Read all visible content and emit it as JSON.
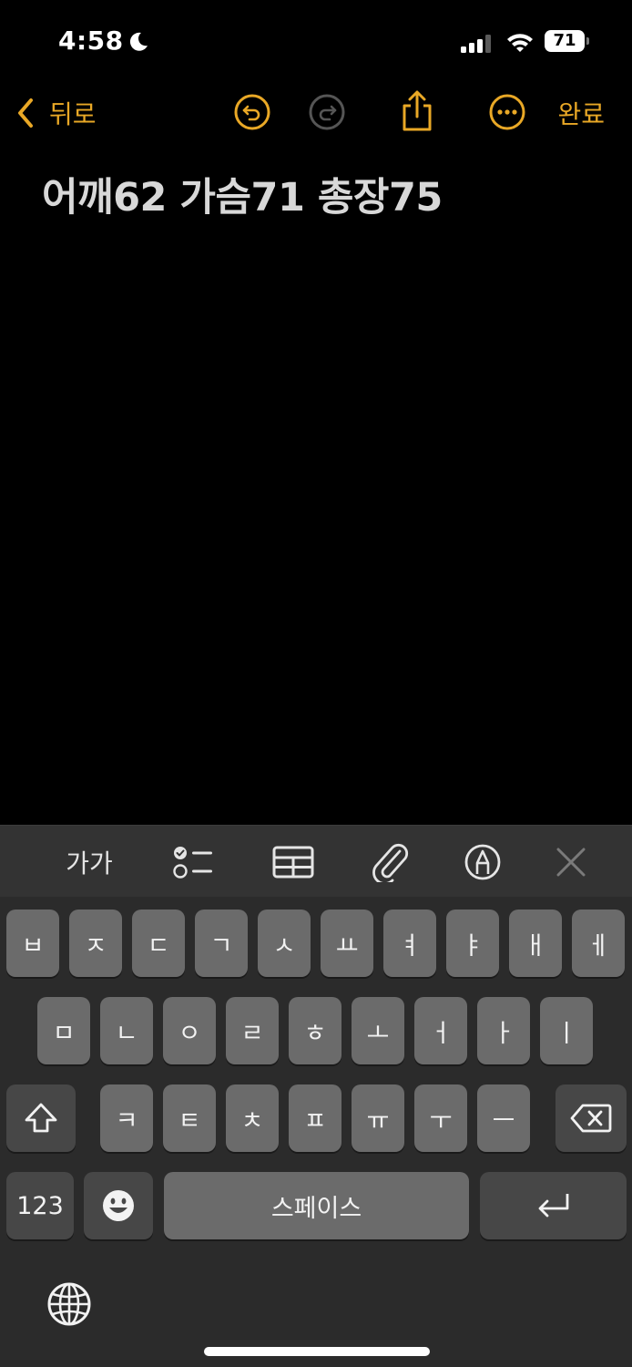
{
  "status": {
    "time": "4:58",
    "battery": "71"
  },
  "nav": {
    "back_label": "뒤로",
    "done_label": "완료"
  },
  "note": {
    "text": "어깨62 가슴71 총장75"
  },
  "toolbar": {
    "format_label": "가가"
  },
  "keyboard": {
    "row1": [
      "ㅂ",
      "ㅈ",
      "ㄷ",
      "ㄱ",
      "ㅅ",
      "ㅛ",
      "ㅕ",
      "ㅑ",
      "ㅐ",
      "ㅔ"
    ],
    "row2": [
      "ㅁ",
      "ㄴ",
      "ㅇ",
      "ㄹ",
      "ㅎ",
      "ㅗ",
      "ㅓ",
      "ㅏ",
      "ㅣ"
    ],
    "row3": [
      "ㅋ",
      "ㅌ",
      "ㅊ",
      "ㅍ",
      "ㅠ",
      "ㅜ",
      "ㅡ"
    ],
    "numbers_label": "123",
    "space_label": "스페이스"
  },
  "colors": {
    "accent": "#e9a826",
    "background": "#000000",
    "keyboard": "#2b2b2b",
    "key": "#6b6b6b",
    "key_dark": "#474747"
  },
  "icons": [
    "moon-icon",
    "signal-icon",
    "wifi-icon",
    "battery-icon",
    "chevron-left-icon",
    "undo-icon",
    "redo-icon",
    "share-icon",
    "more-icon",
    "checklist-icon",
    "table-icon",
    "paperclip-icon",
    "markup-icon",
    "close-icon",
    "shift-icon",
    "delete-icon",
    "emoji-icon",
    "return-icon",
    "globe-icon"
  ]
}
